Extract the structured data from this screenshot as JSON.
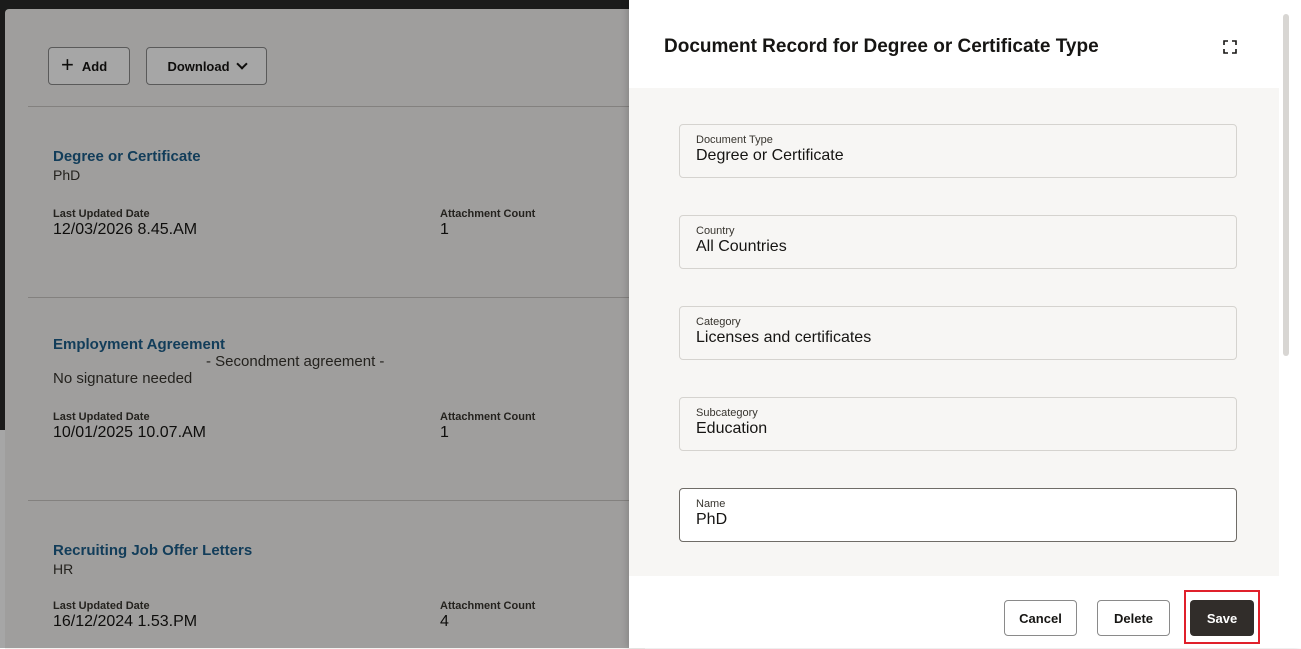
{
  "toolbar": {
    "add_label": "Add",
    "download_label": "Download"
  },
  "documents": [
    {
      "title": "Degree or Certificate",
      "subtitle": "PhD",
      "last_updated_label": "Last Updated Date",
      "last_updated_value": "12/03/2026 8.45.AM",
      "attachment_label": "Attachment Count",
      "attachment_value": "1"
    },
    {
      "title": "Employment Agreement",
      "subtitle_line1": "- Secondment agreement -",
      "subtitle_line2": "No signature needed",
      "last_updated_label": "Last Updated Date",
      "last_updated_value": "10/01/2025 10.07.AM",
      "attachment_label": "Attachment Count",
      "attachment_value": "1"
    },
    {
      "title": "Recruiting Job Offer Letters",
      "subtitle": "HR",
      "last_updated_label": "Last Updated Date",
      "last_updated_value": "16/12/2024 1.53.PM",
      "attachment_label": "Attachment Count",
      "attachment_value": "4"
    }
  ],
  "drawer": {
    "title": "Document Record for Degree or Certificate Type",
    "fields": [
      {
        "label": "Document Type",
        "value": "Degree or Certificate"
      },
      {
        "label": "Country",
        "value": "All Countries"
      },
      {
        "label": "Category",
        "value": "Licenses and certificates"
      },
      {
        "label": "Subcategory",
        "value": "Education"
      },
      {
        "label": "Name",
        "value": "PhD"
      }
    ],
    "buttons": {
      "cancel": "Cancel",
      "delete": "Delete",
      "save": "Save"
    }
  },
  "colors": {
    "link": "#1d5e8a",
    "primary_button": "#312d2a",
    "highlight": "#e0202b"
  }
}
